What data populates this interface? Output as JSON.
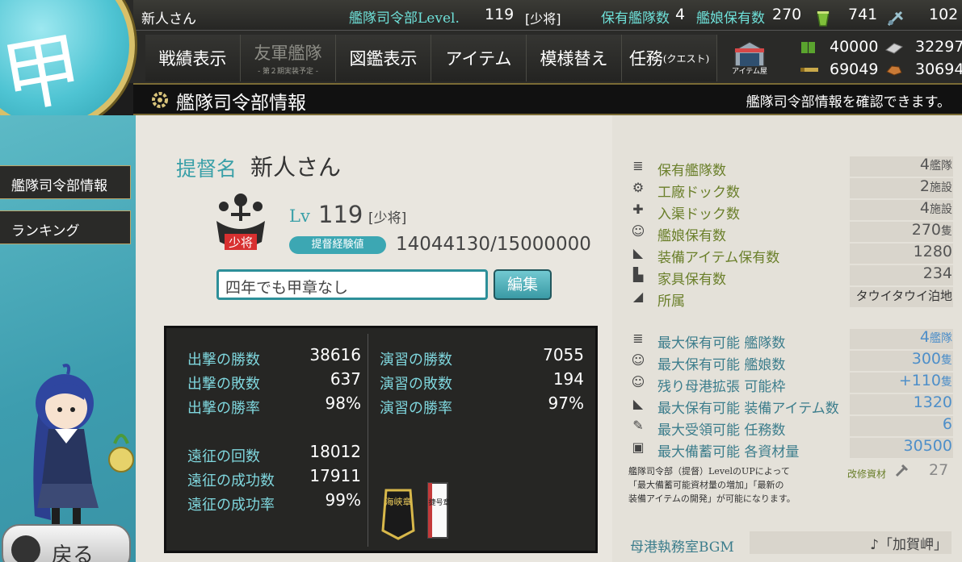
{
  "top": {
    "admiral_name": "新人さん",
    "level_label": "艦隊司令部Level.",
    "level_value": "119",
    "rank": "[少将]",
    "fleets_label": "保有艦隊数",
    "fleets_value": "4",
    "ships_label": "艦娘保有数",
    "ships_value": "270",
    "bucket_value": "741",
    "devmat_value": "102"
  },
  "menu": [
    {
      "label": "戦績表示",
      "sub": "",
      "disabled": false
    },
    {
      "label": "友軍艦隊",
      "sub": "- 第２期実装予定 -",
      "disabled": true
    },
    {
      "label": "図鑑表示",
      "sub": "",
      "disabled": false
    },
    {
      "label": "アイテム",
      "sub": "",
      "disabled": false
    },
    {
      "label": "模様替え",
      "sub": "",
      "disabled": false
    },
    {
      "label": "任務",
      "small": "(クエスト)",
      "sub": "",
      "disabled": false
    }
  ],
  "itemshop_label": "アイテム屋",
  "resources": {
    "fuel": "40000",
    "steel": "32297",
    "ammo": "69049",
    "bauxite": "30694"
  },
  "header": {
    "title": "艦隊司令部情報",
    "hint": "艦隊司令部情報を確認できます。"
  },
  "sidebar": {
    "items": [
      {
        "label": "艦隊司令部情報"
      },
      {
        "label": "ランキング"
      }
    ],
    "back": "戻る"
  },
  "profile": {
    "admiral_label": "提督名",
    "admiral_name": "新人さん",
    "lv_label": "Lv",
    "lv_value": "119",
    "rank": "[少将]",
    "rank_badge_text": "少将",
    "exp_label": "提督経験値",
    "exp_value": "14044130/15000000",
    "comment": "四年でも甲章なし",
    "edit_label": "編集"
  },
  "stats": {
    "left": [
      {
        "label": "出撃の勝数",
        "value": "38616"
      },
      {
        "label": "出撃の敗数",
        "value": "637"
      },
      {
        "label": "出撃の勝率",
        "value": "98%"
      },
      {
        "label": "遠征の回数",
        "value": "18012"
      },
      {
        "label": "遠征の成功数",
        "value": "17911"
      },
      {
        "label": "遠征の成功率",
        "value": "99%"
      }
    ],
    "right": [
      {
        "label": "演習の勝数",
        "value": "7055"
      },
      {
        "label": "演習の敗数",
        "value": "194"
      },
      {
        "label": "演習の勝率",
        "value": "97%"
      }
    ],
    "medal1": "海峡章",
    "medal2": "捷号章"
  },
  "info": [
    {
      "label": "保有艦隊数",
      "value": "4",
      "unit": "艦隊",
      "icon": "fleet-icon"
    },
    {
      "label": "工廠ドック数",
      "value": "2",
      "unit": "施設",
      "icon": "gear-icon"
    },
    {
      "label": "入渠ドック数",
      "value": "4",
      "unit": "施設",
      "icon": "repair-icon"
    },
    {
      "label": "艦娘保有数",
      "value": "270",
      "unit": "隻",
      "icon": "shipgirl-icon"
    },
    {
      "label": "装備アイテム保有数",
      "value": "1280",
      "unit": "",
      "icon": "equipment-icon"
    },
    {
      "label": "家具保有数",
      "value": "234",
      "unit": "",
      "icon": "furniture-icon"
    },
    {
      "label": "所属",
      "value": "タウイタウイ泊地",
      "unit": "",
      "icon": "base-icon"
    }
  ],
  "max_info": [
    {
      "label": "最大保有可能 艦隊数",
      "value": "4",
      "unit": "艦隊",
      "icon": "fleet-icon"
    },
    {
      "label": "最大保有可能 艦娘数",
      "value": "300",
      "unit": "隻",
      "icon": "shipgirl-icon"
    },
    {
      "label": "残り母港拡張 可能枠",
      "value": "+110",
      "unit": "隻",
      "icon": "port-icon"
    },
    {
      "label": "最大保有可能 装備アイテム数",
      "value": "1320",
      "unit": "",
      "icon": "equipment-icon"
    },
    {
      "label": "最大受領可能 任務数",
      "value": "6",
      "unit": "",
      "icon": "quest-icon"
    },
    {
      "label": "最大備蓄可能 各資材量",
      "value": "30500",
      "unit": "",
      "icon": "storage-icon"
    }
  ],
  "note_lines": [
    "艦隊司令部（提督）LevelのUPによって",
    "「最大備蓄可能資材量の増加」「最新の",
    "装備アイテムの開発」が可能になります。"
  ],
  "repair": {
    "label": "改修資材",
    "value": "27"
  },
  "bgm": {
    "label": "母港執務室BGM",
    "value": "♪「加賀岬」"
  }
}
